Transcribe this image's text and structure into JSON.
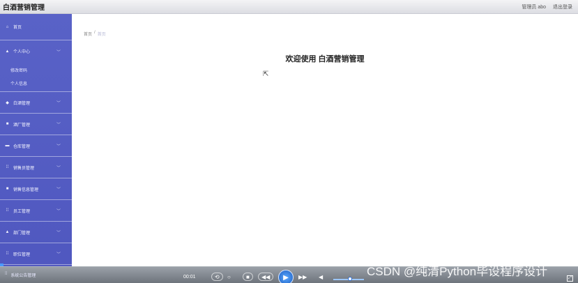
{
  "app": {
    "title": "白酒营销管理"
  },
  "topbar": {
    "user_label": "管理员 abo",
    "logout_label": "退出登录"
  },
  "sidebar": {
    "items": [
      {
        "icon": "home-icon",
        "glyph": "⌂",
        "label": "首页",
        "chevron": false
      },
      {
        "icon": "user-icon",
        "glyph": "▲",
        "label": "个人中心",
        "chevron": true,
        "children": [
          "修改密码",
          "个人信息"
        ]
      },
      {
        "icon": "lock-icon",
        "glyph": "◆",
        "label": "白酒管理",
        "chevron": true
      },
      {
        "icon": "box-icon",
        "glyph": "■",
        "label": "酒厂管理",
        "chevron": true
      },
      {
        "icon": "list-icon",
        "glyph": "▬",
        "label": "仓库管理",
        "chevron": true
      },
      {
        "icon": "grid-icon",
        "glyph": "⁞⁞",
        "label": "销售员管理",
        "chevron": true
      },
      {
        "icon": "doc-icon",
        "glyph": "■",
        "label": "销售信息管理",
        "chevron": true
      },
      {
        "icon": "grid-icon",
        "glyph": "⁞⁞",
        "label": "员工管理",
        "chevron": true
      },
      {
        "icon": "user-icon",
        "glyph": "▲",
        "label": "部门管理",
        "chevron": true
      },
      {
        "icon": "grid-icon",
        "glyph": "⁞⁞",
        "label": "职位管理",
        "chevron": true
      }
    ],
    "bottom_item": {
      "glyph": "⁞⁞",
      "label": "系统公告管理"
    }
  },
  "main": {
    "breadcrumb": {
      "root": "首页",
      "separator": "/",
      "current": "首页"
    },
    "welcome": "欢迎使用 白酒营销管理"
  },
  "player": {
    "time": "00:01",
    "controls": [
      "⟲",
      "○",
      "■",
      "◀◀",
      "▶",
      "▶▶",
      "◀"
    ],
    "progress_percent": 0.6,
    "volume_percent": 50
  },
  "watermark": "CSDN @纯清Python毕设程序设计"
}
